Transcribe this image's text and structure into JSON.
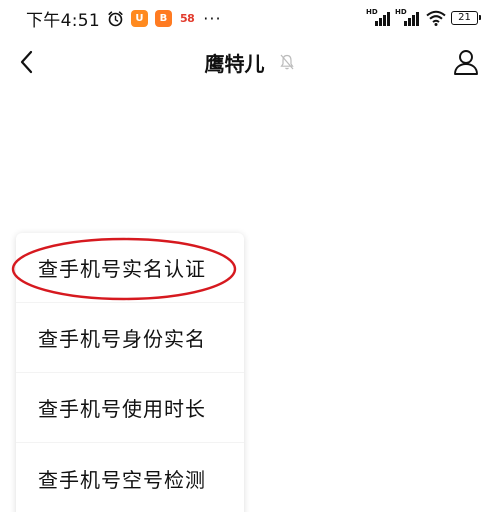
{
  "status_bar": {
    "time": "下午4:51",
    "app_icons": [
      {
        "name": "alarm-clock-icon"
      },
      {
        "name": "taobao-app-icon",
        "color": "#ff8a1f",
        "glyph": "U"
      },
      {
        "name": "app-icon-orange",
        "color": "#ff7b22",
        "glyph": "B"
      },
      {
        "name": "app-58-icon",
        "text": "58"
      }
    ],
    "more_indicator": "···",
    "network": [
      "HD",
      "HD"
    ],
    "battery_level": "21"
  },
  "nav": {
    "title": "鹰特儿",
    "back_icon": "chevron-left-icon",
    "mute_icon": "bell-muted-icon",
    "profile_icon": "person-icon"
  },
  "menu": {
    "items": [
      {
        "label": "查手机号实名认证",
        "highlighted": true
      },
      {
        "label": "查手机号身份实名"
      },
      {
        "label": "查手机号使用时长"
      },
      {
        "label": "查手机号空号检测"
      }
    ]
  },
  "colors": {
    "annotation_ellipse": "#d6191f",
    "text_primary": "#111111",
    "menu_divider": "#f3f3f3"
  }
}
